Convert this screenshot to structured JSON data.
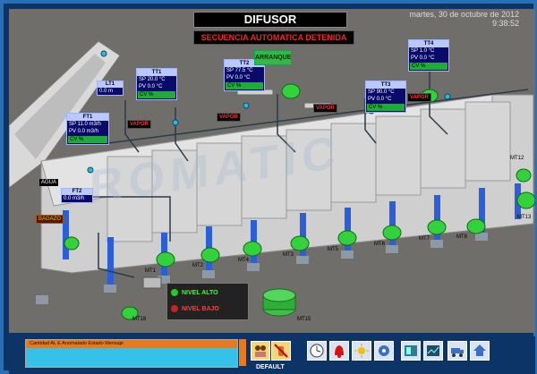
{
  "title": "DIFUSOR",
  "datetime": {
    "date": "martes, 30 de octubre de 2012",
    "time": "9:38:52"
  },
  "sequence_status": "SECUENCIA AUTOMATICA DETENIDA",
  "start_button": "ARRANQUE",
  "watermark": "ROMATIC",
  "temperature_panels": [
    {
      "id": "TT1",
      "sp": "SP 20.0 °C",
      "pv": "PV 0.0 °C",
      "cv": "CV %"
    },
    {
      "id": "TT2",
      "sp": "SP 77.5 °C",
      "pv": "PV 0.0 °C",
      "cv": "CV %"
    },
    {
      "id": "TT3",
      "sp": "SP 90.0 °C",
      "pv": "PV 0.0 °C",
      "cv": "CV %"
    },
    {
      "id": "TT4",
      "sp": "SP 1.0 °C",
      "pv": "PV 0.0 °C",
      "cv": "CV %"
    }
  ],
  "level_panels": [
    {
      "id": "LT1",
      "val": "0.0 m"
    },
    {
      "id": "FT1",
      "sp": "SP 11.0 m3/h",
      "pv": "PV 0.0 m3/h",
      "cv": "CV %"
    },
    {
      "id": "FT2",
      "val": "0.0 m3/h"
    }
  ],
  "vapor_label": "VAPOR",
  "water_label": "AGUA",
  "bagasse_label": "BAGAZO",
  "motors": [
    "MT1",
    "MT2",
    "MT3",
    "MT4",
    "MT5",
    "MT6",
    "MT7",
    "MT8",
    "MT9",
    "MT10",
    "MT11",
    "MT12",
    "MT13",
    "MT14",
    "MT15",
    "MT16"
  ],
  "level_status": {
    "high": "NIVEL ALTO",
    "low": "NIVEL BAJO"
  },
  "message_header": "Cantidad AL   E Anomalado   Estado   Mensaje",
  "default_label": "DEFAULT",
  "toolbar_icons": [
    "people-icon",
    "hand-icon",
    "clock-icon",
    "alarm-bell-icon",
    "sun-icon",
    "settings-icon",
    "panel-icon",
    "trend-icon",
    "truck-icon",
    "home-icon"
  ],
  "colors": {
    "accent": "#2a6fb6",
    "motor": "#33d23c",
    "alarm": "#ff2020"
  }
}
